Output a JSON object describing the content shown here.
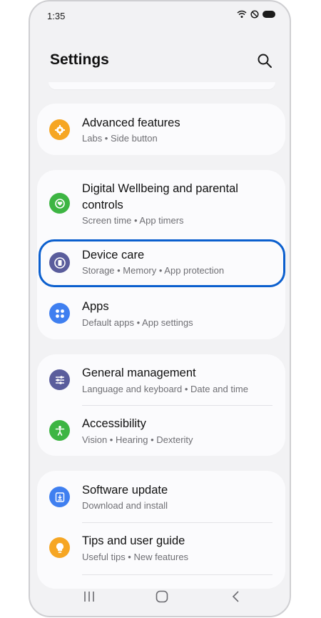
{
  "status_bar": {
    "time": "1:35"
  },
  "header": {
    "title": "Settings"
  },
  "groups": [
    {
      "items": [
        {
          "title": "Advanced features",
          "subtitle": "Labs  •  Side button",
          "icon": "gear-plus-icon",
          "color": "#f6a623"
        }
      ]
    },
    {
      "items": [
        {
          "title": "Digital Wellbeing and parental controls",
          "subtitle": "Screen time  •  App timers",
          "icon": "heart-circle-icon",
          "color": "#3db543"
        },
        {
          "title": "Device care",
          "subtitle": "Storage  •  Memory  •  App protection",
          "icon": "device-care-icon",
          "color": "#5a5d9c"
        },
        {
          "title": "Apps",
          "subtitle": "Default apps  •  App settings",
          "icon": "apps-grid-icon",
          "color": "#3f7ff0"
        }
      ]
    },
    {
      "items": [
        {
          "title": "General management",
          "subtitle": "Language and keyboard  •  Date and time",
          "icon": "sliders-icon",
          "color": "#5a5d9c"
        },
        {
          "title": "Accessibility",
          "subtitle": "Vision  •  Hearing  •  Dexterity",
          "icon": "accessibility-icon",
          "color": "#3db543"
        }
      ]
    },
    {
      "items": [
        {
          "title": "Software update",
          "subtitle": "Download and install",
          "icon": "download-icon",
          "color": "#3f7ff0"
        },
        {
          "title": "Tips and user guide",
          "subtitle": "Useful tips  •  New features",
          "icon": "lightbulb-icon",
          "color": "#f6a623"
        }
      ]
    }
  ],
  "highlight": {
    "target": "Device care",
    "color": "#0b5fce"
  },
  "navbar": {
    "buttons": [
      "recent-apps-icon",
      "home-icon",
      "back-icon"
    ]
  }
}
